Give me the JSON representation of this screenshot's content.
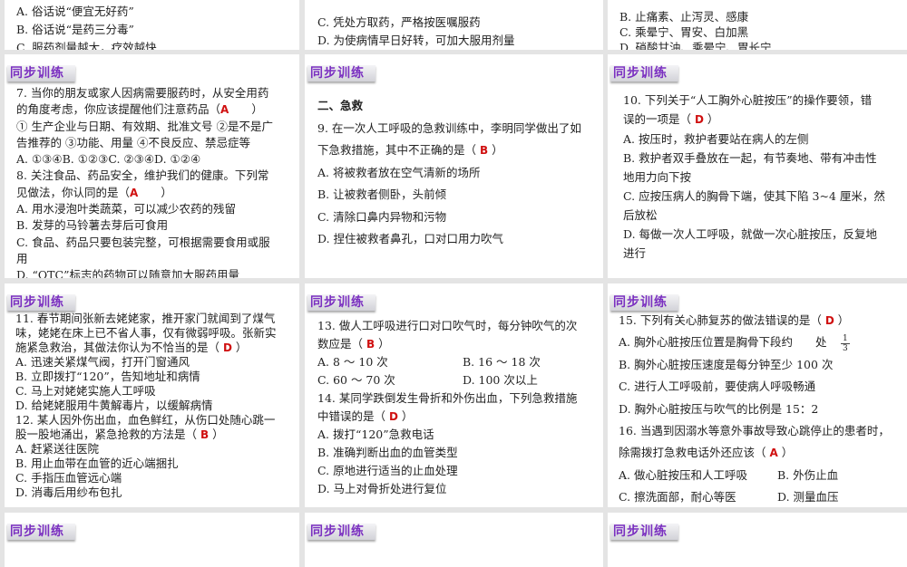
{
  "badge_label": "同步训练",
  "panels": [
    {
      "id": "r1c1",
      "badge": false,
      "lines": [
        {
          "t": "A. 俗话说“便宜无好药”"
        },
        {
          "t": "B. 俗话说“是药三分毒”"
        },
        {
          "t": "C. 服药剂量越大，疗效越快"
        }
      ]
    },
    {
      "id": "r1c2",
      "badge": false,
      "lines": [
        {
          "t": "C. 凭处方取药，严格按医嘱服药"
        },
        {
          "t": "D. 为使病情早日好转，可加大服用剂量"
        }
      ]
    },
    {
      "id": "r1c3",
      "badge": false,
      "lines": [
        {
          "t": "B. 止痛素、止泻灵、感康"
        },
        {
          "t": "C. 乘晕宁、胃安、白加黑"
        },
        {
          "t": "D. 硝酸甘油、乘晕宁、胃长宁"
        }
      ]
    },
    {
      "id": "r2c1",
      "badge": true,
      "lines": [
        {
          "t": "7. 当你的朋友或家人因病需要服药时，从安全用药"
        },
        {
          "t": "的角度考虑，你应该提醒他们注意药品（",
          "a": "A",
          "s": "　　）"
        },
        {
          "t": "① 生产企业与日期、有效期、批准文号 ②是不是广"
        },
        {
          "t": "告推荐的 ③功能、用量 ④不良反应、禁忌症等"
        },
        {
          "t": "A. ①③④B. ①②③C. ②③④D. ①②④"
        },
        {
          "t": "8. 关注食品、药品安全，维护我们的健康。下列常"
        },
        {
          "t": "见做法，你认同的是（",
          "a": "A",
          "s": "　　）"
        },
        {
          "t": "A. 用水浸泡叶类蔬菜，可以减少农药的残留"
        },
        {
          "t": "B. 发芽的马铃薯去芽后可食用"
        },
        {
          "t": "C. 食品、药品只要包装完整，可根据需要食用或服"
        },
        {
          "t": "用"
        },
        {
          "t": "D. “OTC”标志的药物可以随意加大服药用量"
        }
      ]
    },
    {
      "id": "r2c2",
      "badge": true,
      "lines": [
        {
          "t": "二、急救",
          "sec": true
        },
        {
          "t": "9. 在一次人工呼吸的急救训练中，李明同学做出了如"
        },
        {
          "t": "下急救措施，其中不正确的是（ ",
          "a": "B",
          "s": " ）"
        },
        {
          "t": "A. 将被救者放在空气清新的场所"
        },
        {
          "t": "B. 让被救者侧卧，头前倾"
        },
        {
          "t": "C. 清除口鼻内异物和污物"
        },
        {
          "t": "D. 捏住被救者鼻孔，口对口用力吹气"
        }
      ]
    },
    {
      "id": "r2c3",
      "badge": true,
      "lines": [
        {
          "t": "10. 下列关于“人工胸外心脏按压”的操作要领，错"
        },
        {
          "t": "误的一项是（ ",
          "a": "D",
          "s": " ）"
        },
        {
          "t": "A. 按压时，救护者要站在病人的左侧"
        },
        {
          "t": "B. 救护者双手叠放在一起，有节奏地、带有冲击性"
        },
        {
          "t": "地用力向下按"
        },
        {
          "t": "C. 应按压病人的胸骨下端，使其下陷 3~4 厘米，然"
        },
        {
          "t": "后放松"
        },
        {
          "t": "D. 每做一次人工呼吸，就做一次心脏按压，反复地"
        },
        {
          "t": "进行"
        }
      ]
    },
    {
      "id": "r3c1",
      "badge": true,
      "lines": [
        {
          "t": "11. 春节期间张新去姥姥家，推开家门就闻到了煤气"
        },
        {
          "t": "味，姥姥在床上已不省人事，仅有微弱呼吸。张新实"
        },
        {
          "t": "施紧急救治，其做法你认为不恰当的是（ ",
          "a": "D",
          "s": " ）"
        },
        {
          "t": "A. 迅速关紧煤气阀，打开门窗通风"
        },
        {
          "t": "B. 立即拨打“120”，告知地址和病情"
        },
        {
          "t": "C. 马上对姥姥实施人工呼吸"
        },
        {
          "t": "D. 给姥姥服用牛黄解毒片，以缓解病情"
        },
        {
          "t": "12. 某人因外伤出血，血色鲜红，从伤口处随心跳一"
        },
        {
          "t": "股一股地涌出，紧急抢救的方法是（ ",
          "a": "B",
          "s": " ）"
        },
        {
          "t": "A. 赶紧送往医院"
        },
        {
          "t": "B. 用止血带在血管的近心端捆扎"
        },
        {
          "t": "C. 手指压血管远心端"
        },
        {
          "t": "D. 消毒后用纱布包扎"
        }
      ]
    },
    {
      "id": "r3c2",
      "badge": true,
      "lines": [
        {
          "t": "13. 做人工呼吸进行口对口吹气时，每分钟吹气的次"
        },
        {
          "t": "数应是（ ",
          "a": "B",
          "s": " ）"
        },
        {
          "t": "A. 8 ～ 10 次",
          "c2": "B. 16 ～ 18 次"
        },
        {
          "t": "C. 60 ～ 70 次",
          "c2": "D. 100 次以上"
        },
        {
          "t": "14. 某同学跌倒发生骨折和外伤出血，下列急救措施"
        },
        {
          "t": "中错误的是（ ",
          "a": "D",
          "s": " ）"
        },
        {
          "t": "A. 拨打“120”急救电话"
        },
        {
          "t": "B. 准确判断出血的血管类型"
        },
        {
          "t": "C. 原地进行适当的止血处理"
        },
        {
          "t": "D. 马上对骨折处进行复位"
        }
      ]
    },
    {
      "id": "r3c3",
      "badge": true,
      "lines": [
        {
          "t": "15. 下列有关心肺复苏的做法错误的是（ ",
          "a": "D",
          "s": " ）"
        },
        {
          "t": "A. 胸外心脏按压位置是胸骨下段约　　处",
          "fn": "1",
          "fd": "3"
        },
        {
          "t": "B. 胸外心脏按压速度是每分钟至少 100 次"
        },
        {
          "t": "C. 进行人工呼吸前，要使病人呼吸畅通"
        },
        {
          "t": "D. 胸外心脏按压与吹气的比例是 15：2"
        },
        {
          "t": "16. 当遇到因溺水等意外事故导致心跳停止的患者时，"
        },
        {
          "t": "除需拨打急救电话外还应该（ ",
          "a": "A",
          "s": " ）"
        },
        {
          "t": "A. 做心脏按压和人工呼吸",
          "c2": "B. 外伤止血"
        },
        {
          "t": "C. 擦洗面部，耐心等医",
          "c2": "D. 测量血压"
        }
      ]
    },
    {
      "id": "r4c1",
      "badge": true,
      "lines": []
    },
    {
      "id": "r4c2",
      "badge": true,
      "lines": []
    },
    {
      "id": "r4c3",
      "badge": true,
      "lines": []
    }
  ]
}
